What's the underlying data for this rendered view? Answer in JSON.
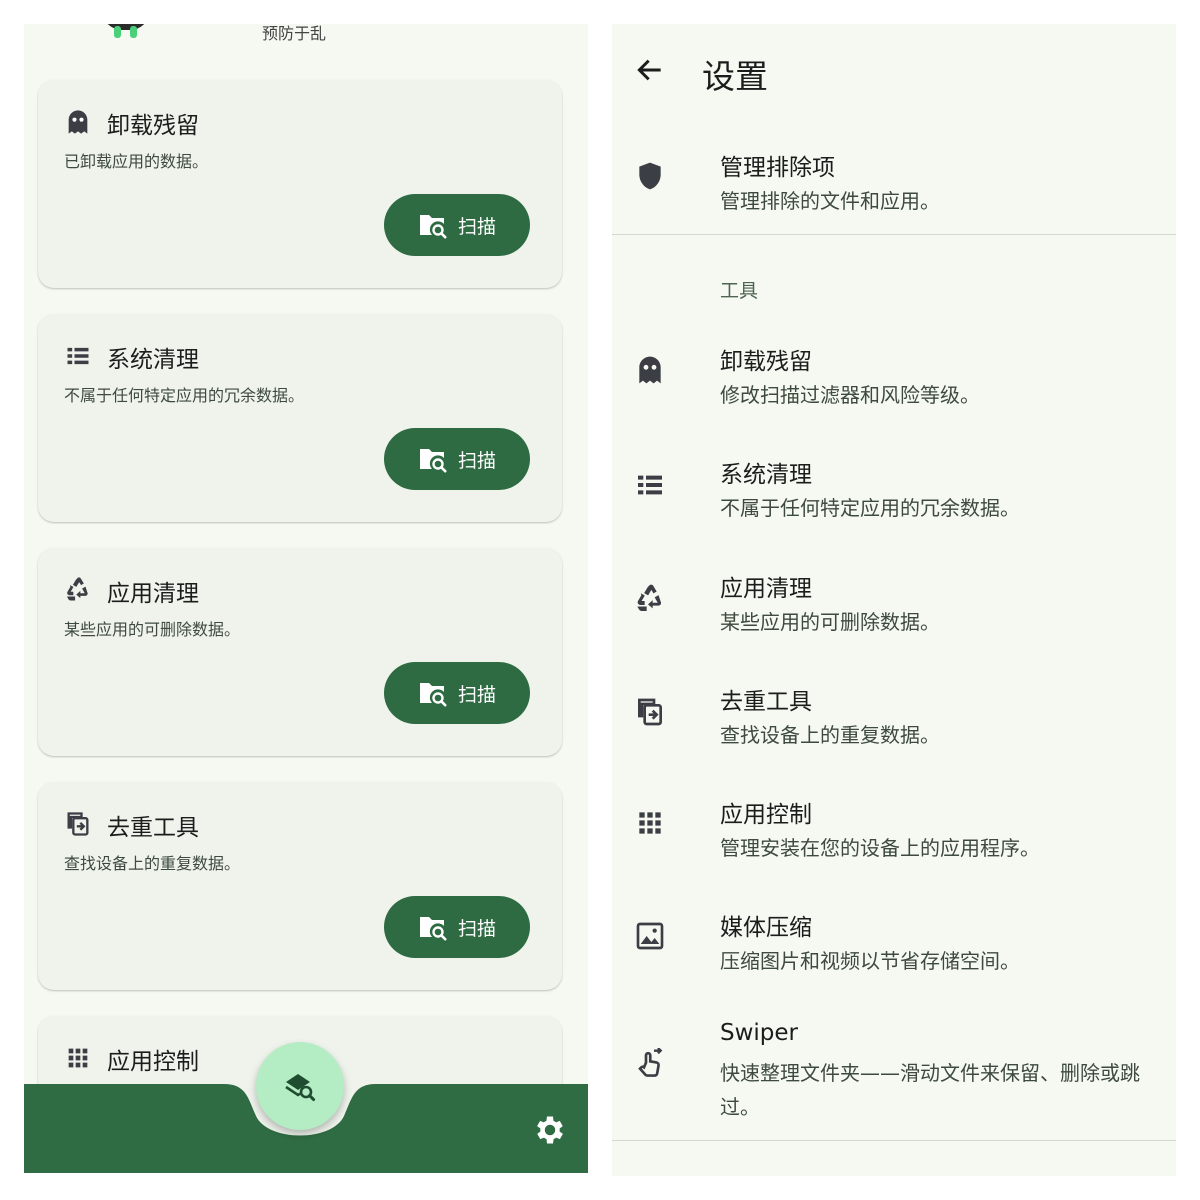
{
  "left": {
    "header_subtitle": "预防于乱",
    "cards": [
      {
        "title": "卸载残留",
        "desc": "已卸载应用的数据。",
        "button": "扫描",
        "icon": "ghost-icon"
      },
      {
        "title": "系统清理",
        "desc": "不属于任何特定应用的冗余数据。",
        "button": "扫描",
        "icon": "list-icon"
      },
      {
        "title": "应用清理",
        "desc": "某些应用的可删除数据。",
        "button": "扫描",
        "icon": "recycle-icon"
      },
      {
        "title": "去重工具",
        "desc": "查找设备上的重复数据。",
        "button": "扫描",
        "icon": "duplicate-icon"
      },
      {
        "title": "应用控制",
        "desc": "",
        "button": "",
        "icon": "apps-grid-icon"
      }
    ],
    "fab_icon": "scan-all-icon",
    "settings_icon": "gear-icon"
  },
  "right": {
    "title": "设置",
    "exclusions": {
      "title": "管理排除项",
      "desc": "管理排除的文件和应用。"
    },
    "section_tools": "工具",
    "items": [
      {
        "title": "卸载残留",
        "desc": "修改扫描过滤器和风险等级。",
        "icon": "ghost-icon"
      },
      {
        "title": "系统清理",
        "desc": "不属于任何特定应用的冗余数据。",
        "icon": "list-icon"
      },
      {
        "title": "应用清理",
        "desc": "某些应用的可删除数据。",
        "icon": "recycle-icon"
      },
      {
        "title": "去重工具",
        "desc": "查找设备上的重复数据。",
        "icon": "duplicate-icon"
      },
      {
        "title": "应用控制",
        "desc": "管理安装在您的设备上的应用程序。",
        "icon": "apps-grid-icon"
      },
      {
        "title": "媒体压缩",
        "desc": "压缩图片和视频以节省存储空间。",
        "icon": "image-icon"
      },
      {
        "title": "Swiper",
        "desc": "快速整理文件夹——滑动文件来保留、删除或跳过。",
        "icon": "swipe-icon"
      }
    ]
  },
  "colors": {
    "background": "#f5f9f1",
    "card": "#eff3ec",
    "primary": "#2e6b43",
    "fab": "#b4ecc4",
    "icon": "#3b3f45"
  }
}
